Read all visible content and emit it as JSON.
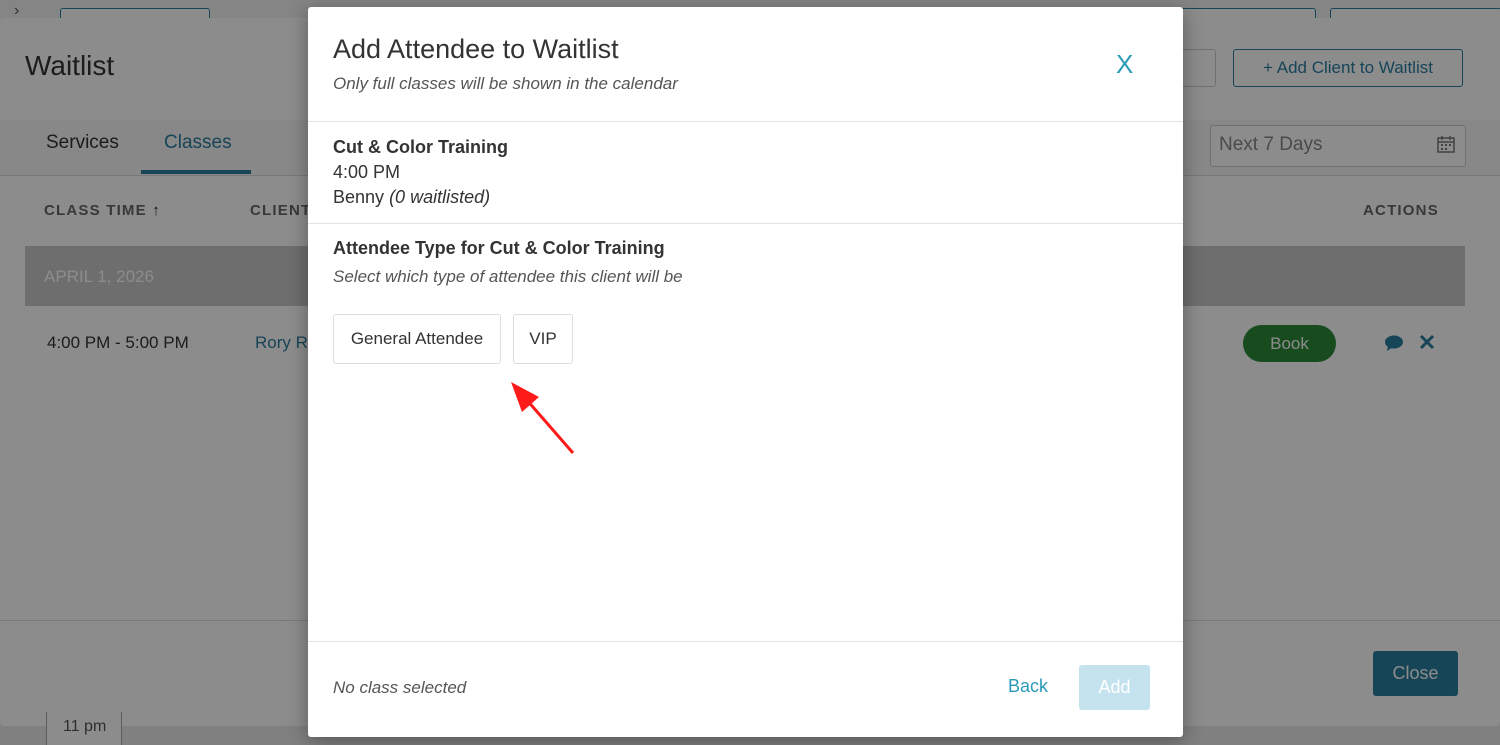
{
  "background": {
    "title": "Waitlist",
    "add_client_label": "+ Add Client to Waitlist",
    "tabs": [
      {
        "label": "Services"
      },
      {
        "label": "Classes"
      }
    ],
    "date_filter": "Next 7 Days",
    "columns": {
      "class_time": "CLASS TIME",
      "client": "CLIENT",
      "actions": "ACTIONS"
    },
    "date_band": "APRIL 1, 2026",
    "row": {
      "time": "4:00 PM - 5:00 PM",
      "client": "Rory R",
      "book_label": "Book"
    },
    "close_label": "Close",
    "bottom_cell": "11 pm"
  },
  "modal": {
    "title": "Add Attendee to Waitlist",
    "subtitle": "Only full classes will be shown in the calendar",
    "close_label": "X",
    "class": {
      "name": "Cut & Color Training",
      "time": "4:00 PM",
      "instructor": "Benny",
      "waitlisted": "(0 waitlisted)"
    },
    "attendee_type": {
      "heading": "Attendee Type for Cut & Color Training",
      "subtitle": "Select which type of attendee this client will be",
      "options": [
        {
          "label": "General Attendee"
        },
        {
          "label": "VIP"
        }
      ]
    },
    "footer": {
      "status": "No class selected",
      "back_label": "Back",
      "add_label": "Add"
    }
  },
  "colors": {
    "accent": "#2a7fa0",
    "book_green": "#2d8a3a",
    "annotation_arrow": "#ff1a1a"
  }
}
